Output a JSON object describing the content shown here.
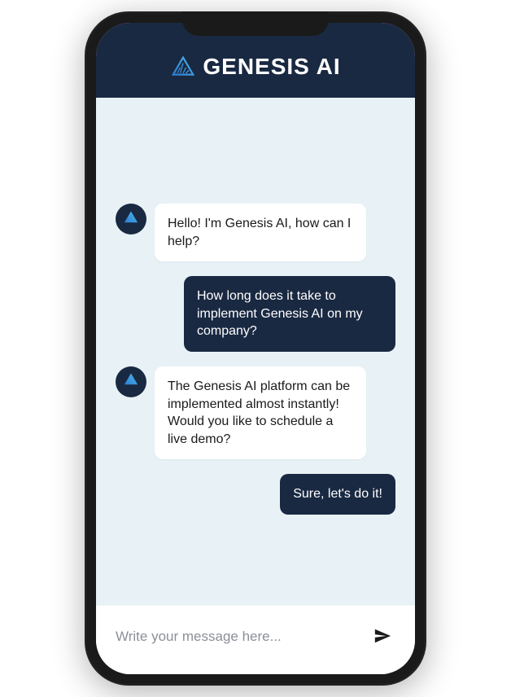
{
  "header": {
    "brand_name": "GENESIS AI"
  },
  "messages": [
    {
      "role": "assistant",
      "text": "Hello! I'm Genesis AI, how can I help?"
    },
    {
      "role": "user",
      "text": "How long does it take to implement Genesis AI on my company?"
    },
    {
      "role": "assistant",
      "text": "The Genesis AI platform can be implemented almost instantly! Would you like to schedule a live demo?"
    },
    {
      "role": "user",
      "text": "Sure, let's do it!"
    }
  ],
  "input": {
    "placeholder": "Write your message here..."
  },
  "colors": {
    "header_bg": "#1a2942",
    "screen_bg": "#e8f2f6",
    "user_bubble_bg": "#1a2942",
    "assistant_bubble_bg": "#ffffff",
    "accent_blue_1": "#2b7fd6",
    "accent_blue_2": "#4db8e8"
  },
  "icons": {
    "brand_logo": "triangle-logo-icon",
    "avatar": "triangle-logo-icon",
    "send": "paper-plane-icon"
  }
}
